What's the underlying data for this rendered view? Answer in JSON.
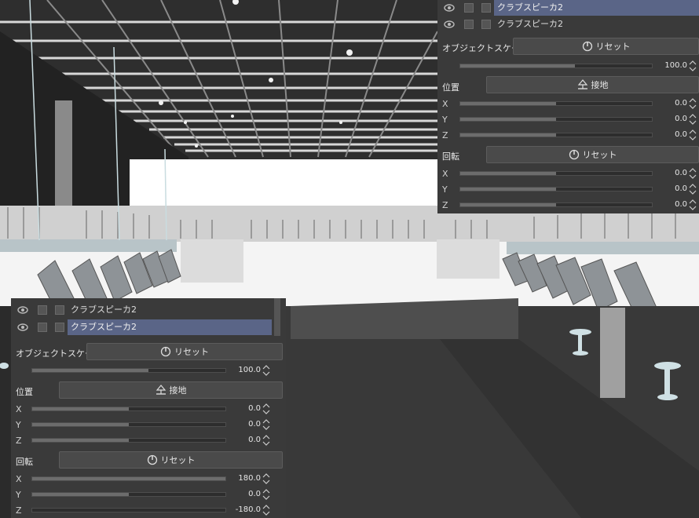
{
  "left_panel": {
    "layers": [
      {
        "name": "クラブスピーカ2",
        "selected": false
      },
      {
        "name": "クラブスピーカ2",
        "selected": true
      }
    ],
    "object_scale": {
      "label": "オブジェクトスケール",
      "reset_label": "リセット",
      "value": "100.0"
    },
    "position": {
      "label": "位置",
      "ground_label": "接地",
      "x": "0.0",
      "y": "0.0",
      "z": "0.0"
    },
    "rotation": {
      "label": "回転",
      "reset_label": "リセット",
      "x": "180.0",
      "y": "0.0",
      "z": "-180.0"
    }
  },
  "right_panel": {
    "layers": [
      {
        "name": "クラブスピーカ2",
        "selected": true
      },
      {
        "name": "クラブスピーカ2",
        "selected": false
      }
    ],
    "object_scale": {
      "label": "オブジェクトスケール",
      "reset_label": "リセット",
      "value": "100.0"
    },
    "position": {
      "label": "位置",
      "ground_label": "接地",
      "x": "0.0",
      "y": "0.0",
      "z": "0.0"
    },
    "rotation": {
      "label": "回転",
      "reset_label": "リセット",
      "x": "0.0",
      "y": "0.0",
      "z": "0.0"
    }
  },
  "axis_labels": {
    "x": "X",
    "y": "Y",
    "z": "Z"
  },
  "icons": {
    "visibility": "eye-icon",
    "reset": "reset-icon",
    "ground": "ground-icon",
    "spinner": "spinner-arrows-icon"
  },
  "colors": {
    "panel_bg": "#3a3a3a",
    "selected_row": "#5a6587",
    "button_bg": "#4a4a4a"
  }
}
